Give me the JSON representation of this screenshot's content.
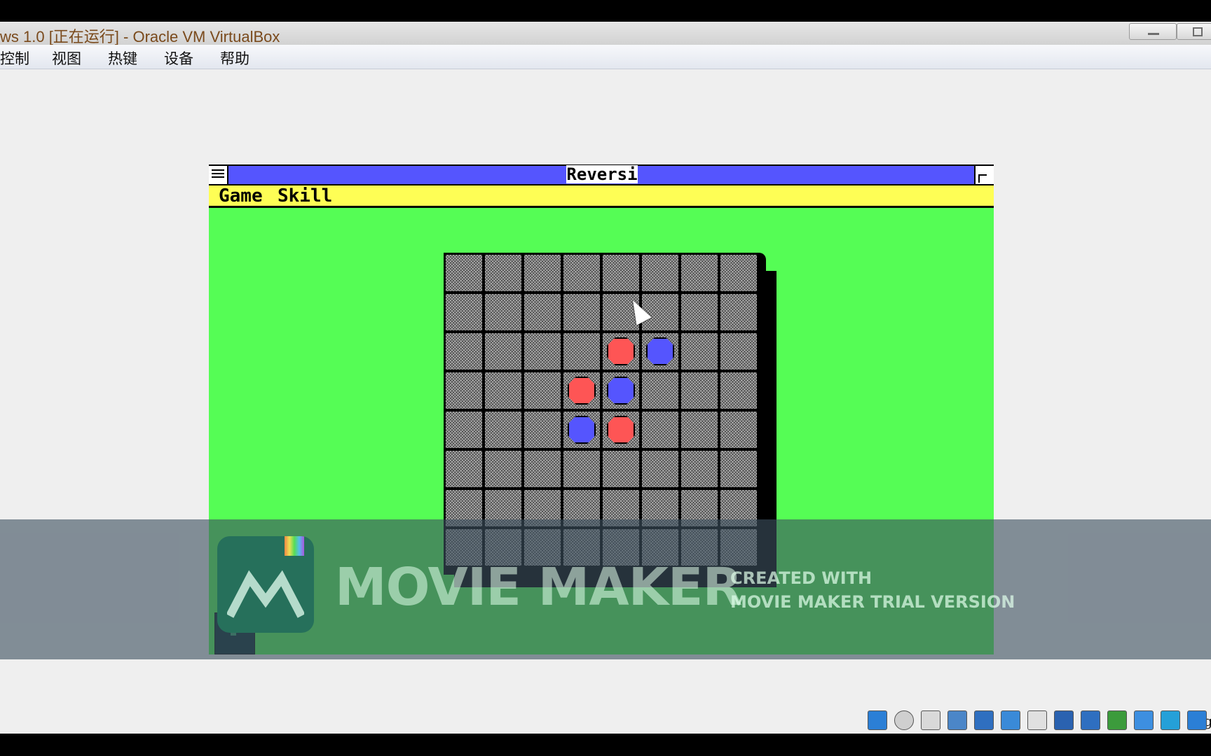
{
  "host_window": {
    "title": "ws 1.0 [正在运行] - Oracle VM VirtualBox",
    "menu": [
      "控制",
      "视图",
      "热键",
      "设备",
      "帮助"
    ]
  },
  "guest_window": {
    "title": "Reversi",
    "menu": [
      "Game",
      "Skill"
    ],
    "board": {
      "size": 8,
      "pieces": [
        {
          "row": 2,
          "col": 4,
          "color": "red"
        },
        {
          "row": 2,
          "col": 5,
          "color": "blue"
        },
        {
          "row": 3,
          "col": 3,
          "color": "red"
        },
        {
          "row": 3,
          "col": 4,
          "color": "blue"
        },
        {
          "row": 4,
          "col": 3,
          "color": "blue"
        },
        {
          "row": 4,
          "col": 4,
          "color": "red"
        }
      ],
      "colors": {
        "red": "#fe5555",
        "blue": "#5555fe"
      }
    }
  },
  "watermark": {
    "brand": "MOVIE MAKER",
    "line1": "CREATED WITH",
    "line2": "MOVIE MAKER TRIAL VERSION"
  },
  "statusbar": {
    "icons": [
      "hard-disk-icon",
      "optical-drive-icon",
      "floppy-icon",
      "audio-icon",
      "network-icon",
      "usb-icon",
      "shared-folders-icon",
      "display-icon",
      "video-capture-icon",
      "settings-icon",
      "cpu-icon",
      "mouse-integration-icon",
      "keyboard-icon"
    ],
    "host_key": "Rig"
  }
}
